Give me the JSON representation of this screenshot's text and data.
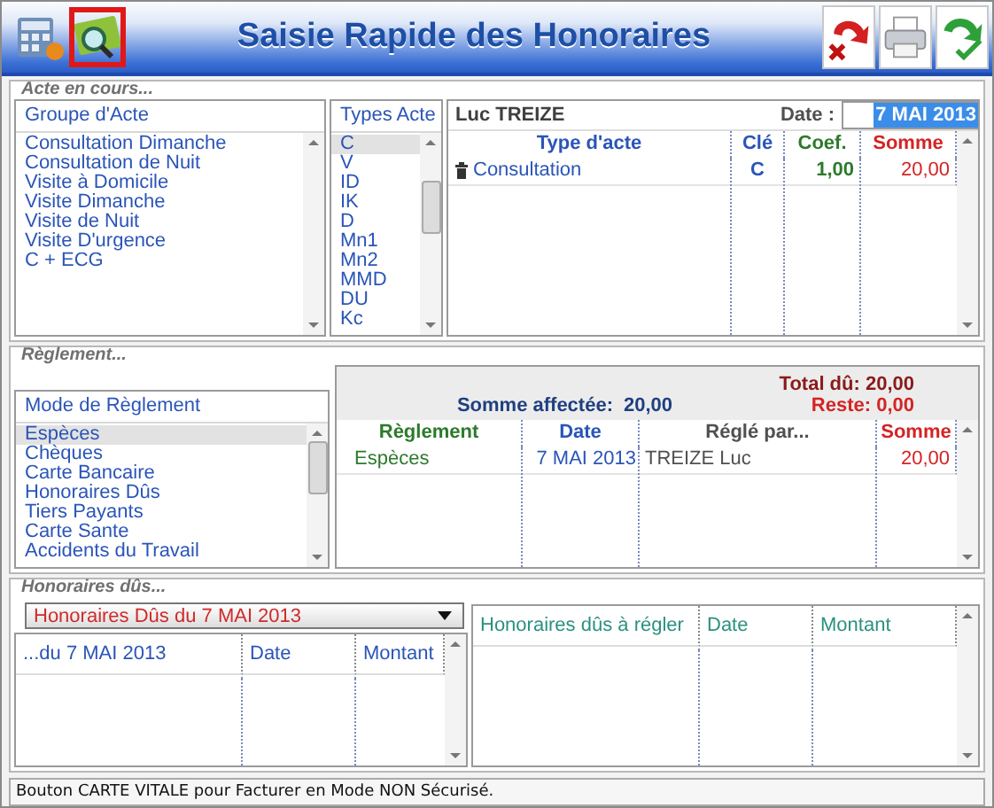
{
  "window": {
    "title": "Saisie Rapide des Honoraires"
  },
  "toolbar_left": [
    {
      "kind": "calculator",
      "selected": false
    },
    {
      "kind": "card",
      "selected": true
    }
  ],
  "toolbar_right": [
    {
      "kind": "cancel"
    },
    {
      "kind": "print"
    },
    {
      "kind": "validate"
    }
  ],
  "acte": {
    "section_title": "Acte en cours...",
    "groups": {
      "header": "Groupe d'Acte",
      "items": [
        {
          "label": "Consultation Dimanche",
          "selected": false
        },
        {
          "label": "Consultation de Nuit",
          "selected": false
        },
        {
          "label": "Visite à Domicile",
          "selected": false
        },
        {
          "label": "Visite Dimanche",
          "selected": false
        },
        {
          "label": "Visite de Nuit",
          "selected": false
        },
        {
          "label": "Visite D'urgence",
          "selected": false
        },
        {
          "label": "C + ECG",
          "selected": false
        }
      ]
    },
    "types": {
      "header": "Types Acte",
      "items": [
        {
          "label": "C",
          "selected": true
        },
        {
          "label": "V",
          "selected": false
        },
        {
          "label": "ID",
          "selected": false
        },
        {
          "label": "IK",
          "selected": false
        },
        {
          "label": "D",
          "selected": false
        },
        {
          "label": "Mn1",
          "selected": false
        },
        {
          "label": "Mn2",
          "selected": false
        },
        {
          "label": "MMD",
          "selected": false
        },
        {
          "label": "DU",
          "selected": false
        },
        {
          "label": "Kc",
          "selected": false
        }
      ]
    },
    "patient": "Luc TREIZE",
    "date_label": "Date :",
    "date": "7 MAI 2013",
    "columns": [
      "Type d'acte",
      "Clé",
      "Coef.",
      "Somme"
    ],
    "rows": [
      {
        "type": "Consultation",
        "key": "C",
        "coef": "1,00",
        "amount": "20,00"
      }
    ]
  },
  "reglement": {
    "section_title": "Règlement...",
    "modes": {
      "header": "Mode de Règlement",
      "items": [
        {
          "label": "Espèces",
          "selected": true
        },
        {
          "label": "Chèques",
          "selected": false
        },
        {
          "label": "Carte Bancaire",
          "selected": false
        },
        {
          "label": "Honoraires Dûs",
          "selected": false
        },
        {
          "label": "Tiers Payants",
          "selected": false
        },
        {
          "label": "Carte Sante",
          "selected": false
        },
        {
          "label": "Accidents du Travail",
          "selected": false
        }
      ]
    },
    "total": "Total dû: 20,00",
    "remaining": "Reste: 0,00",
    "assigned_label": "Somme affectée:",
    "assigned": "20,00",
    "columns": [
      "Règlement",
      "Date",
      "Réglé par...",
      "Somme"
    ],
    "rows": [
      {
        "mode": "Espèces",
        "date": "7 MAI 2013",
        "payer": "TREIZE Luc",
        "amount": "20,00"
      }
    ]
  },
  "honoraires": {
    "section_title": "Honoraires dûs...",
    "dropdown": "Honoraires Dûs du 7 MAI 2013",
    "left_columns": [
      "...du 7 MAI 2013",
      "Date",
      "Montant"
    ],
    "right_columns": [
      "Honoraires dûs à régler",
      "Date",
      "Montant"
    ]
  },
  "status_bar": "Bouton CARTE VITALE pour Facturer en Mode NON Sécurisé."
}
